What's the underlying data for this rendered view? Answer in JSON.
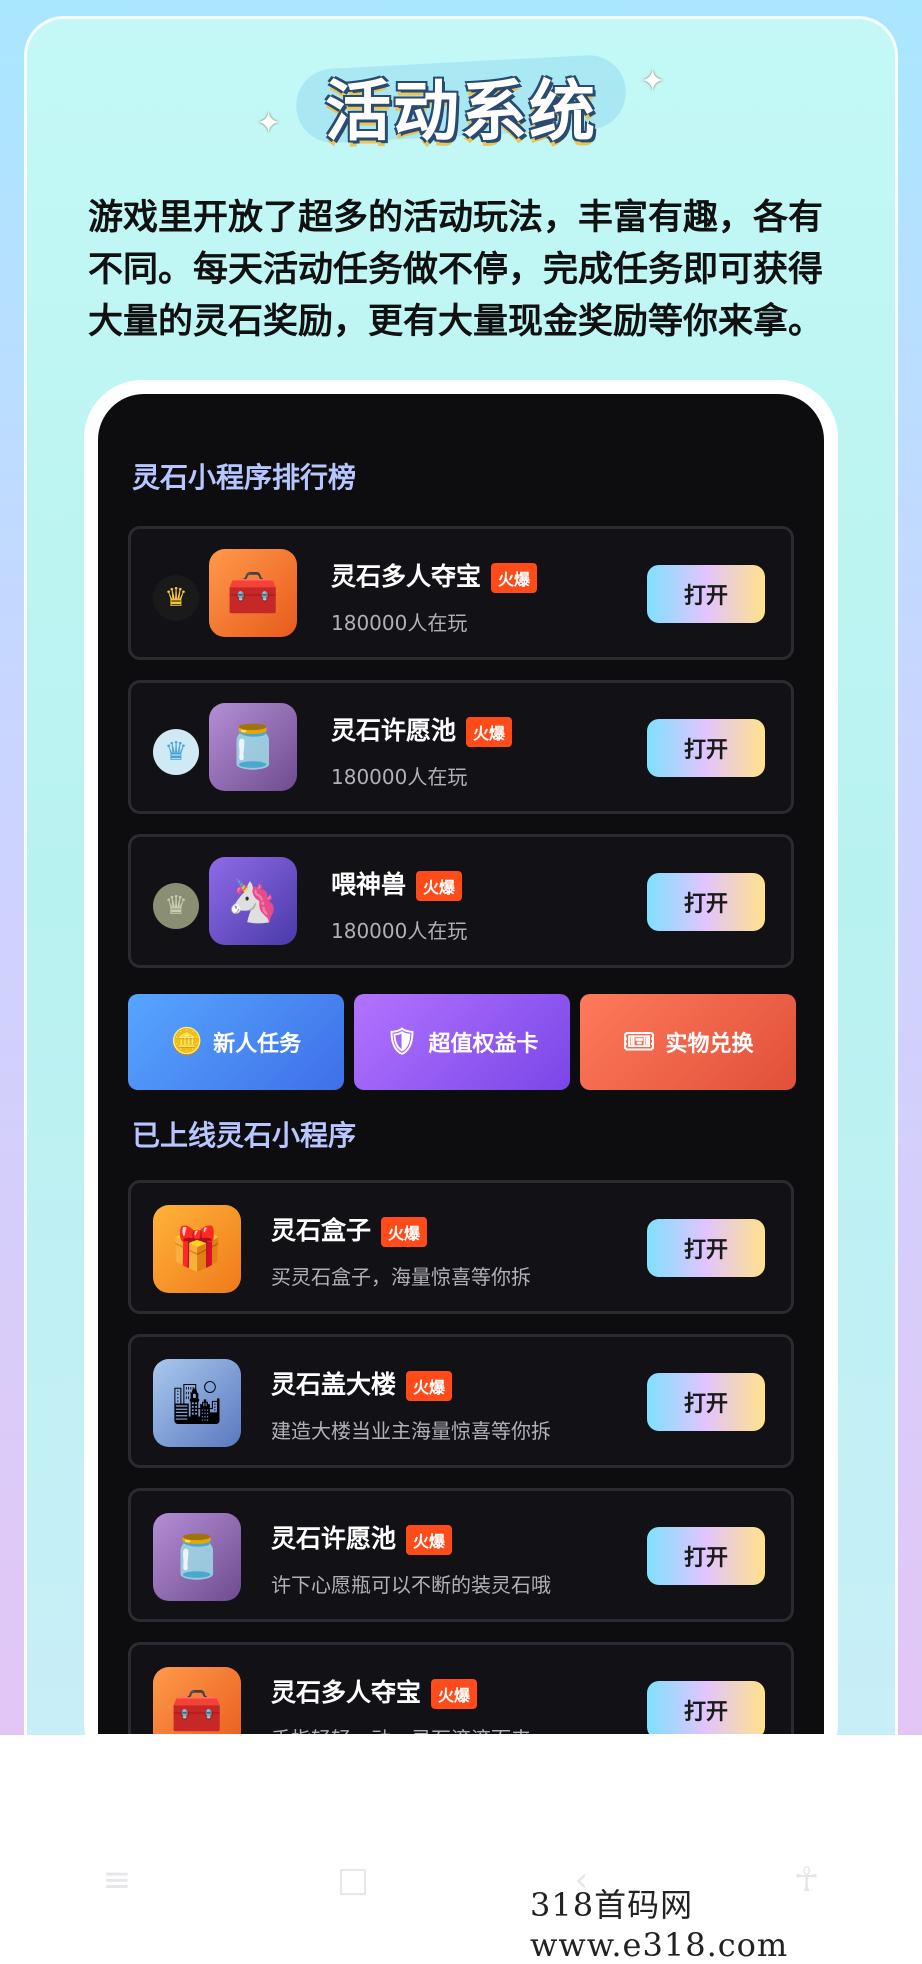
{
  "header": {
    "title": "活动系统",
    "intro": "游戏里开放了超多的活动玩法，丰富有趣，各有不同。每天活动任务做不停，完成任务即可获得大量的灵石奖励，更有大量现金奖励等你来拿。"
  },
  "ranking": {
    "title": "灵石小程序排行榜",
    "items": [
      {
        "name": "灵石多人夺宝",
        "badge": "火爆",
        "players": "180000人在玩",
        "button": "打开",
        "crown": "gold-crown-icon",
        "icon": "treasure-chest-icon"
      },
      {
        "name": "灵石许愿池",
        "badge": "火爆",
        "players": "180000人在玩",
        "button": "打开",
        "crown": "silver-crown-icon",
        "icon": "wish-jar-icon"
      },
      {
        "name": "喂神兽",
        "badge": "火爆",
        "players": "180000人在玩",
        "button": "打开",
        "crown": "bronze-crown-icon",
        "icon": "unicorn-icon"
      }
    ]
  },
  "promos": [
    {
      "label": "新人任务",
      "icon": "coin-stack-icon",
      "color": "#3f8cf5"
    },
    {
      "label": "超值权益卡",
      "icon": "shield-card-icon",
      "color": "#8a55f0"
    },
    {
      "label": "实物兑换",
      "icon": "ticket-icon",
      "color": "#f06048"
    }
  ],
  "online": {
    "title": "已上线灵石小程序",
    "items": [
      {
        "name": "灵石盒子",
        "badge": "火爆",
        "desc": "买灵石盒子，海量惊喜等你拆",
        "button": "打开",
        "icon": "gift-box-icon"
      },
      {
        "name": "灵石盖大楼",
        "badge": "火爆",
        "desc": "建造大楼当业主海量惊喜等你拆",
        "button": "打开",
        "icon": "buildings-icon"
      },
      {
        "name": "灵石许愿池",
        "badge": "火爆",
        "desc": "许下心愿瓶可以不断的装灵石哦",
        "button": "打开",
        "icon": "wish-jar-icon"
      },
      {
        "name": "灵石多人夺宝",
        "badge": "火爆",
        "desc": "手指轻轻一动，灵石滚滚而来",
        "button": "打开",
        "icon": "treasure-chest-icon"
      }
    ]
  },
  "watermark": "318首码网  www.e318.com"
}
